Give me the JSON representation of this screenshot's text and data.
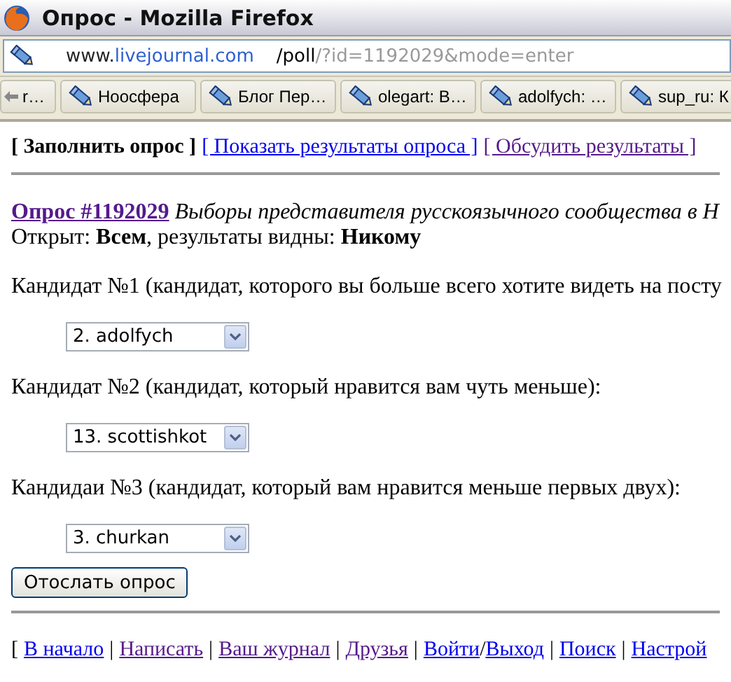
{
  "window": {
    "title": "Опрос - Mozilla Firefox"
  },
  "address_bar": {
    "parts": [
      {
        "text": "www.",
        "kind": "host"
      },
      {
        "text": "livejournal.com",
        "kind": "domain"
      },
      {
        "text": "/poll",
        "kind": "path"
      },
      {
        "text": "/?id=1192029&mode=enter",
        "kind": "query"
      }
    ]
  },
  "bookmarks": [
    {
      "label": "r…",
      "kind": "back"
    },
    {
      "label": "Ноосфера",
      "kind": "page"
    },
    {
      "label": "Блог Пер…",
      "kind": "page"
    },
    {
      "label": "olegart: В…",
      "kind": "page"
    },
    {
      "label": "adolfych: …",
      "kind": "page"
    },
    {
      "label": "sup_ru: К",
      "kind": "page"
    }
  ],
  "poll_tabs": [
    {
      "label": "[ Заполнить опрос ]",
      "kind": "current"
    },
    {
      "label": "[ Показать результаты опроса ]",
      "kind": "link",
      "visited": false
    },
    {
      "label": "[ Обсудить результаты ]",
      "kind": "link",
      "visited": true
    }
  ],
  "poll": {
    "title_link": "Опрос #1192029",
    "title_visited": true,
    "description": "Выборы представителя русскоязычного сообщества в Н",
    "access": "Открыт: **Всем**, результаты видны: **Никому**"
  },
  "questions": [
    {
      "text": "Кандидат №1 (кандидат, которого вы больше всего хотите видеть на посту",
      "selected_option": "2. adolfych"
    },
    {
      "text": "Кандидат №2 (кандидат, который нравится вам чуть меньше):",
      "selected_option": "13. scottishkot"
    },
    {
      "text": "Кандидаи №3 (кандидат, который вам нравится меньше первых двух):",
      "selected_option": "3. churkan"
    }
  ],
  "submit_button": "Отослать опрос",
  "footer": [
    {
      "text": "[",
      "kind": "text"
    },
    {
      "text": "В начало",
      "kind": "link",
      "visited": false
    },
    {
      "text": "|",
      "kind": "text"
    },
    {
      "text": "Написать",
      "kind": "link",
      "visited": true
    },
    {
      "text": "|",
      "kind": "text"
    },
    {
      "text": "Ваш журнал",
      "kind": "link",
      "visited": true
    },
    {
      "text": "|",
      "kind": "text"
    },
    {
      "text": "Друзья",
      "kind": "link",
      "visited": true
    },
    {
      "text": "|",
      "kind": "text"
    },
    {
      "text": "Войти",
      "kind": "link",
      "visited": false
    },
    {
      "text": "/",
      "kind": "slash"
    },
    {
      "text": "Выход",
      "kind": "link",
      "visited": false
    },
    {
      "text": "|",
      "kind": "text"
    },
    {
      "text": "Поиск",
      "kind": "link",
      "visited": false
    },
    {
      "text": "|",
      "kind": "text"
    },
    {
      "text": "Настрой",
      "kind": "link",
      "visited": false
    }
  ]
}
